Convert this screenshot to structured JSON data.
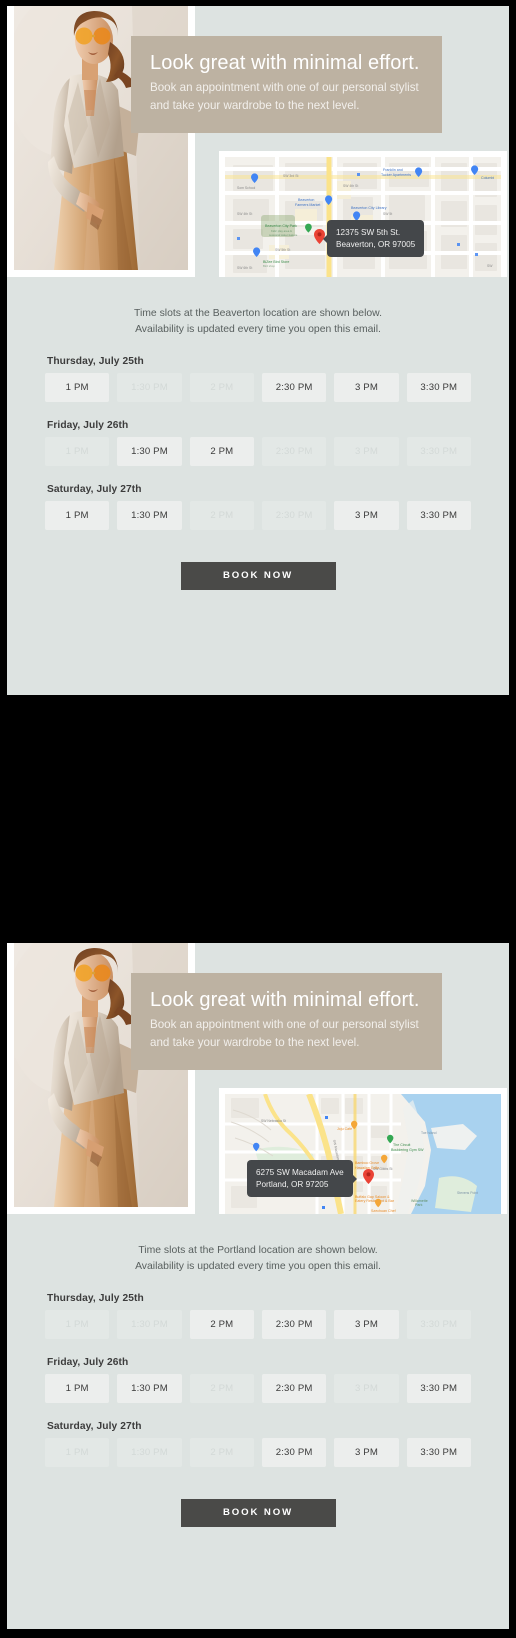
{
  "emails": [
    {
      "id": "beaverton",
      "banner": {
        "headline": "Look great with minimal effort.",
        "sub_line_1": "Book an appointment with one of our personal stylist",
        "sub_line_2": "and take your wardrobe to the next level.",
        "bg_color": "#bdb2a2"
      },
      "map": {
        "address_line_1": "12375 SW 5th St.",
        "address_line_2": "Beaverton, OR 97005",
        "pin_color": "#ea4335",
        "tooltip_side": "right",
        "labels": [
          "Som School",
          "Beaverton Farmers Market",
          "Beaverton City Park",
          "Kids' play area & seasonal water feature",
          "Beaverton City Library",
          "Franklin and Tucker Apartments",
          "Columbi",
          "BiZee Bird Store",
          "Bird shop",
          "SW 3rd St",
          "SW 4th St",
          "SW 5th St",
          "SW 6th St",
          "SW Hall Blvd",
          "Tucker Ave",
          "Village Home Education"
        ]
      },
      "intro_line_1": "Time slots at the Beaverton location are shown below.",
      "intro_line_2": "Availability is updated every time you open this email.",
      "days": [
        {
          "label": "Thursday, July 25th",
          "slots": [
            {
              "time": "1 PM",
              "available": true
            },
            {
              "time": "1:30 PM",
              "available": false
            },
            {
              "time": "2 PM",
              "available": false
            },
            {
              "time": "2:30 PM",
              "available": true
            },
            {
              "time": "3 PM",
              "available": true
            },
            {
              "time": "3:30 PM",
              "available": true
            }
          ]
        },
        {
          "label": "Friday, July 26th",
          "slots": [
            {
              "time": "1 PM",
              "available": false
            },
            {
              "time": "1:30 PM",
              "available": true
            },
            {
              "time": "2 PM",
              "available": true
            },
            {
              "time": "2:30 PM",
              "available": false
            },
            {
              "time": "3 PM",
              "available": false
            },
            {
              "time": "3:30 PM",
              "available": false
            }
          ]
        },
        {
          "label": "Saturday, July 27th",
          "slots": [
            {
              "time": "1 PM",
              "available": true
            },
            {
              "time": "1:30 PM",
              "available": true
            },
            {
              "time": "2 PM",
              "available": false
            },
            {
              "time": "2:30 PM",
              "available": false
            },
            {
              "time": "3 PM",
              "available": true
            },
            {
              "time": "3:30 PM",
              "available": true
            }
          ]
        }
      ],
      "cta_label": "BOOK NOW"
    },
    {
      "id": "portland",
      "banner": {
        "headline": "Look great with minimal effort.",
        "sub_line_1": "Book an appointment with one of our personal stylist",
        "sub_line_2": "and take your wardrobe to the next level.",
        "bg_color": "#bdb2a2"
      },
      "map": {
        "address_line_1": "6275 SW Macadam Ave",
        "address_line_2": "Portland, OR 97205",
        "pin_color": "#ea4335",
        "tooltip_side": "left",
        "labels": [
          "Toe Island",
          "Joju Cafe",
          "The Circuit Bouldering Gym SW",
          "Bamboo Grove Hawaiian Grille",
          "Buffalo Gap Saloon & Eatery Restaurant & Bar",
          "Stevens Point",
          "Szechuan Chef",
          "Willamette Park",
          "SW Macadam Ave",
          "SW Nebraska St"
        ]
      },
      "intro_line_1": "Time slots at the Portland location are shown below.",
      "intro_line_2": "Availability is updated every time you open this email.",
      "days": [
        {
          "label": "Thursday, July 25th",
          "slots": [
            {
              "time": "1 PM",
              "available": false
            },
            {
              "time": "1:30 PM",
              "available": false
            },
            {
              "time": "2 PM",
              "available": true
            },
            {
              "time": "2:30 PM",
              "available": true
            },
            {
              "time": "3 PM",
              "available": true
            },
            {
              "time": "3:30 PM",
              "available": false
            }
          ]
        },
        {
          "label": "Friday, July 26th",
          "slots": [
            {
              "time": "1 PM",
              "available": true
            },
            {
              "time": "1:30 PM",
              "available": true
            },
            {
              "time": "2 PM",
              "available": false
            },
            {
              "time": "2:30 PM",
              "available": true
            },
            {
              "time": "3 PM",
              "available": false
            },
            {
              "time": "3:30 PM",
              "available": true
            }
          ]
        },
        {
          "label": "Saturday, July 27th",
          "slots": [
            {
              "time": "1 PM",
              "available": false
            },
            {
              "time": "1:30 PM",
              "available": false
            },
            {
              "time": "2 PM",
              "available": false
            },
            {
              "time": "2:30 PM",
              "available": true
            },
            {
              "time": "3 PM",
              "available": true
            },
            {
              "time": "3:30 PM",
              "available": true
            }
          ]
        }
      ],
      "cta_label": "BOOK NOW"
    }
  ],
  "colors": {
    "card_bg": "#dde3e1",
    "banner": "#bdb2a2",
    "cta": "#4a4a48",
    "slot_open": "#eceeed",
    "slot_taken": "#e3e8e6",
    "page_bg": "#000000"
  }
}
